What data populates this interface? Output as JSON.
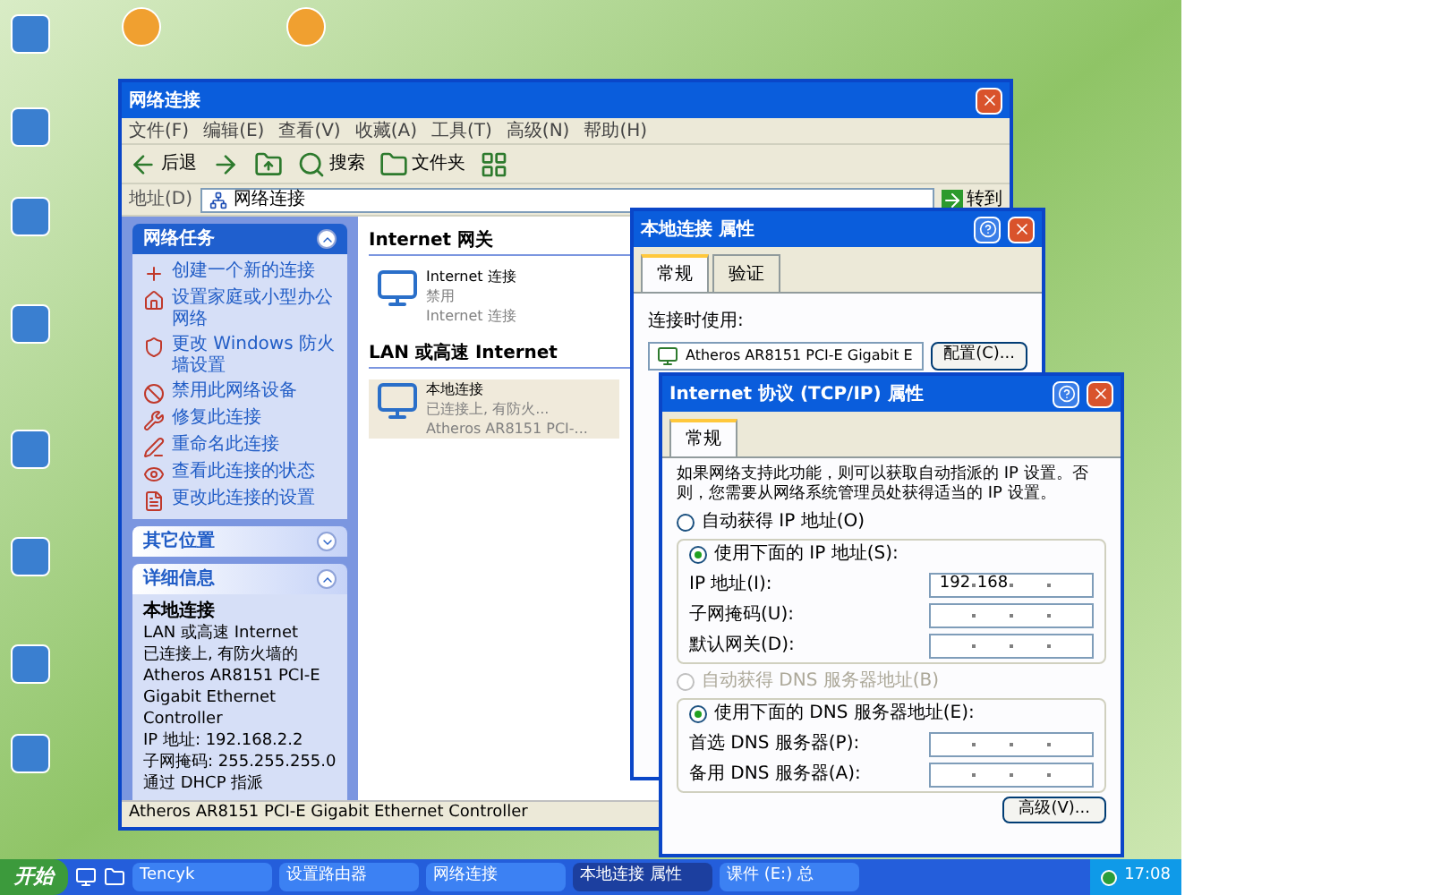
{
  "explorer": {
    "title": "网络连接",
    "menu": [
      "文件(F)",
      "编辑(E)",
      "查看(V)",
      "收藏(A)",
      "工具(T)",
      "高级(N)",
      "帮助(H)"
    ],
    "toolbar": [
      {
        "kind": "back",
        "label": "后退"
      },
      {
        "kind": "forward"
      },
      {
        "kind": "up"
      },
      {
        "kind": "search",
        "label": "搜索"
      },
      {
        "kind": "folders",
        "label": "文件夹"
      },
      {
        "kind": "views"
      }
    ],
    "address": {
      "label": "地址(D)",
      "value": "网络连接",
      "go": "转到"
    },
    "panels": [
      {
        "kind": "tasks",
        "title": "网络任务",
        "expanded": true,
        "items": [
          "创建一个新的连接",
          "设置家庭或小型办公网络",
          "更改 Windows 防火墙设置",
          "禁用此网络设备",
          "修复此连接",
          "重命名此连接",
          "查看此连接的状态",
          "更改此连接的设置"
        ]
      },
      {
        "kind": "places",
        "title": "其它位置",
        "expanded": false
      },
      {
        "kind": "details",
        "title": "详细信息",
        "expanded": true,
        "name": "本地连接",
        "lines": [
          "LAN 或高速 Internet",
          "已连接上, 有防火墙的",
          "Atheros AR8151 PCI-E Gigabit Ethernet Controller",
          "IP 地址: 192.168.2.2",
          "子网掩码: 255.255.255.0",
          "通过 DHCP 指派"
        ]
      }
    ],
    "groups": [
      {
        "title": "Internet 网关",
        "items": [
          {
            "lines": [
              "Internet 连接",
              "禁用",
              "Internet 连接"
            ],
            "selected": false
          }
        ]
      },
      {
        "title": "LAN 或高速 Internet",
        "items": [
          {
            "lines": [
              "本地连接",
              "已连接上, 有防火...",
              "Atheros AR8151 PCI-..."
            ],
            "selected": true
          }
        ]
      }
    ],
    "status_bar": "Atheros AR8151 PCI-E Gigabit Ethernet Controller"
  },
  "properties_dialog": {
    "title": "本地连接 属性",
    "tabs": [
      {
        "label": "常规",
        "selected": true
      },
      {
        "label": "验证",
        "selected": false
      }
    ],
    "connect_using": "连接时使用:",
    "adapter": "Atheros AR8151 PCI-E Gigabit E",
    "configure_button": "配置(C)..."
  },
  "tcpip_dialog": {
    "title": "Internet 协议 (TCP/IP) 属性",
    "tabs": [
      {
        "label": "常规",
        "selected": true
      }
    ],
    "intro": "如果网络支持此功能，则可以获取自动指派的 IP 设置。否则，您需要从网络系统管理员处获得适当的 IP 设置。",
    "ip_options": [
      {
        "label": "自动获得 IP 地址(O)",
        "selected": false,
        "disabled": false
      },
      {
        "label": "使用下面的 IP 地址(S):",
        "selected": true,
        "disabled": false
      }
    ],
    "ip_fields": [
      {
        "label": "IP 地址(I):",
        "octets": [
          "192",
          "168"
        ]
      },
      {
        "label": "子网掩码(U):"
      },
      {
        "label": "默认网关(D):"
      }
    ],
    "dns_options": [
      {
        "label": "自动获得 DNS 服务器地址(B)",
        "selected": false,
        "disabled": true
      },
      {
        "label": "使用下面的 DNS 服务器地址(E):",
        "selected": true,
        "disabled": false
      }
    ],
    "dns_fields": [
      {
        "label": "首选 DNS 服务器(P):"
      },
      {
        "label": "备用 DNS 服务器(A):"
      }
    ],
    "advanced_button": "高级(V)..."
  },
  "taskbar": {
    "start": "开始",
    "tasks": [
      {
        "label": "Tencyk",
        "selected": false
      },
      {
        "label": "设置路由器",
        "selected": false
      },
      {
        "label": "网络连接",
        "selected": false
      },
      {
        "label": "本地连接 属性",
        "selected": true
      },
      {
        "label": "课件 (E:) 总",
        "selected": false
      }
    ],
    "clock": "17:08"
  }
}
